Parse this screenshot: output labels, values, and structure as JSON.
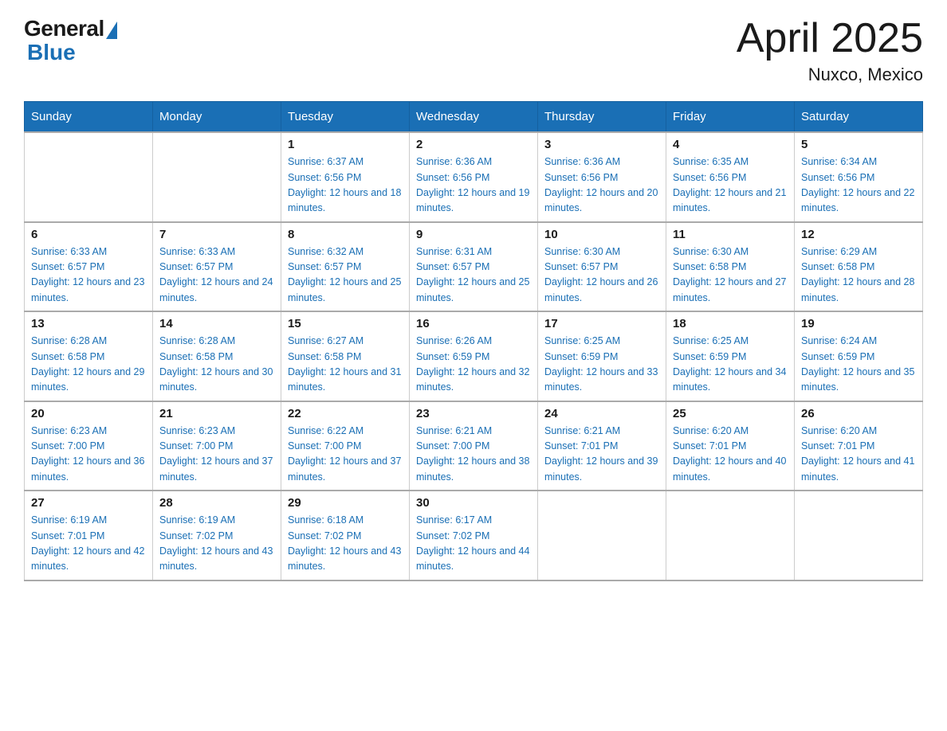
{
  "logo": {
    "general": "General",
    "blue": "Blue"
  },
  "header": {
    "month_year": "April 2025",
    "location": "Nuxco, Mexico"
  },
  "weekdays": [
    "Sunday",
    "Monday",
    "Tuesday",
    "Wednesday",
    "Thursday",
    "Friday",
    "Saturday"
  ],
  "weeks": [
    [
      {
        "day": "",
        "sunrise": "",
        "sunset": "",
        "daylight": ""
      },
      {
        "day": "",
        "sunrise": "",
        "sunset": "",
        "daylight": ""
      },
      {
        "day": "1",
        "sunrise": "Sunrise: 6:37 AM",
        "sunset": "Sunset: 6:56 PM",
        "daylight": "Daylight: 12 hours and 18 minutes."
      },
      {
        "day": "2",
        "sunrise": "Sunrise: 6:36 AM",
        "sunset": "Sunset: 6:56 PM",
        "daylight": "Daylight: 12 hours and 19 minutes."
      },
      {
        "day": "3",
        "sunrise": "Sunrise: 6:36 AM",
        "sunset": "Sunset: 6:56 PM",
        "daylight": "Daylight: 12 hours and 20 minutes."
      },
      {
        "day": "4",
        "sunrise": "Sunrise: 6:35 AM",
        "sunset": "Sunset: 6:56 PM",
        "daylight": "Daylight: 12 hours and 21 minutes."
      },
      {
        "day": "5",
        "sunrise": "Sunrise: 6:34 AM",
        "sunset": "Sunset: 6:56 PM",
        "daylight": "Daylight: 12 hours and 22 minutes."
      }
    ],
    [
      {
        "day": "6",
        "sunrise": "Sunrise: 6:33 AM",
        "sunset": "Sunset: 6:57 PM",
        "daylight": "Daylight: 12 hours and 23 minutes."
      },
      {
        "day": "7",
        "sunrise": "Sunrise: 6:33 AM",
        "sunset": "Sunset: 6:57 PM",
        "daylight": "Daylight: 12 hours and 24 minutes."
      },
      {
        "day": "8",
        "sunrise": "Sunrise: 6:32 AM",
        "sunset": "Sunset: 6:57 PM",
        "daylight": "Daylight: 12 hours and 25 minutes."
      },
      {
        "day": "9",
        "sunrise": "Sunrise: 6:31 AM",
        "sunset": "Sunset: 6:57 PM",
        "daylight": "Daylight: 12 hours and 25 minutes."
      },
      {
        "day": "10",
        "sunrise": "Sunrise: 6:30 AM",
        "sunset": "Sunset: 6:57 PM",
        "daylight": "Daylight: 12 hours and 26 minutes."
      },
      {
        "day": "11",
        "sunrise": "Sunrise: 6:30 AM",
        "sunset": "Sunset: 6:58 PM",
        "daylight": "Daylight: 12 hours and 27 minutes."
      },
      {
        "day": "12",
        "sunrise": "Sunrise: 6:29 AM",
        "sunset": "Sunset: 6:58 PM",
        "daylight": "Daylight: 12 hours and 28 minutes."
      }
    ],
    [
      {
        "day": "13",
        "sunrise": "Sunrise: 6:28 AM",
        "sunset": "Sunset: 6:58 PM",
        "daylight": "Daylight: 12 hours and 29 minutes."
      },
      {
        "day": "14",
        "sunrise": "Sunrise: 6:28 AM",
        "sunset": "Sunset: 6:58 PM",
        "daylight": "Daylight: 12 hours and 30 minutes."
      },
      {
        "day": "15",
        "sunrise": "Sunrise: 6:27 AM",
        "sunset": "Sunset: 6:58 PM",
        "daylight": "Daylight: 12 hours and 31 minutes."
      },
      {
        "day": "16",
        "sunrise": "Sunrise: 6:26 AM",
        "sunset": "Sunset: 6:59 PM",
        "daylight": "Daylight: 12 hours and 32 minutes."
      },
      {
        "day": "17",
        "sunrise": "Sunrise: 6:25 AM",
        "sunset": "Sunset: 6:59 PM",
        "daylight": "Daylight: 12 hours and 33 minutes."
      },
      {
        "day": "18",
        "sunrise": "Sunrise: 6:25 AM",
        "sunset": "Sunset: 6:59 PM",
        "daylight": "Daylight: 12 hours and 34 minutes."
      },
      {
        "day": "19",
        "sunrise": "Sunrise: 6:24 AM",
        "sunset": "Sunset: 6:59 PM",
        "daylight": "Daylight: 12 hours and 35 minutes."
      }
    ],
    [
      {
        "day": "20",
        "sunrise": "Sunrise: 6:23 AM",
        "sunset": "Sunset: 7:00 PM",
        "daylight": "Daylight: 12 hours and 36 minutes."
      },
      {
        "day": "21",
        "sunrise": "Sunrise: 6:23 AM",
        "sunset": "Sunset: 7:00 PM",
        "daylight": "Daylight: 12 hours and 37 minutes."
      },
      {
        "day": "22",
        "sunrise": "Sunrise: 6:22 AM",
        "sunset": "Sunset: 7:00 PM",
        "daylight": "Daylight: 12 hours and 37 minutes."
      },
      {
        "day": "23",
        "sunrise": "Sunrise: 6:21 AM",
        "sunset": "Sunset: 7:00 PM",
        "daylight": "Daylight: 12 hours and 38 minutes."
      },
      {
        "day": "24",
        "sunrise": "Sunrise: 6:21 AM",
        "sunset": "Sunset: 7:01 PM",
        "daylight": "Daylight: 12 hours and 39 minutes."
      },
      {
        "day": "25",
        "sunrise": "Sunrise: 6:20 AM",
        "sunset": "Sunset: 7:01 PM",
        "daylight": "Daylight: 12 hours and 40 minutes."
      },
      {
        "day": "26",
        "sunrise": "Sunrise: 6:20 AM",
        "sunset": "Sunset: 7:01 PM",
        "daylight": "Daylight: 12 hours and 41 minutes."
      }
    ],
    [
      {
        "day": "27",
        "sunrise": "Sunrise: 6:19 AM",
        "sunset": "Sunset: 7:01 PM",
        "daylight": "Daylight: 12 hours and 42 minutes."
      },
      {
        "day": "28",
        "sunrise": "Sunrise: 6:19 AM",
        "sunset": "Sunset: 7:02 PM",
        "daylight": "Daylight: 12 hours and 43 minutes."
      },
      {
        "day": "29",
        "sunrise": "Sunrise: 6:18 AM",
        "sunset": "Sunset: 7:02 PM",
        "daylight": "Daylight: 12 hours and 43 minutes."
      },
      {
        "day": "30",
        "sunrise": "Sunrise: 6:17 AM",
        "sunset": "Sunset: 7:02 PM",
        "daylight": "Daylight: 12 hours and 44 minutes."
      },
      {
        "day": "",
        "sunrise": "",
        "sunset": "",
        "daylight": ""
      },
      {
        "day": "",
        "sunrise": "",
        "sunset": "",
        "daylight": ""
      },
      {
        "day": "",
        "sunrise": "",
        "sunset": "",
        "daylight": ""
      }
    ]
  ]
}
